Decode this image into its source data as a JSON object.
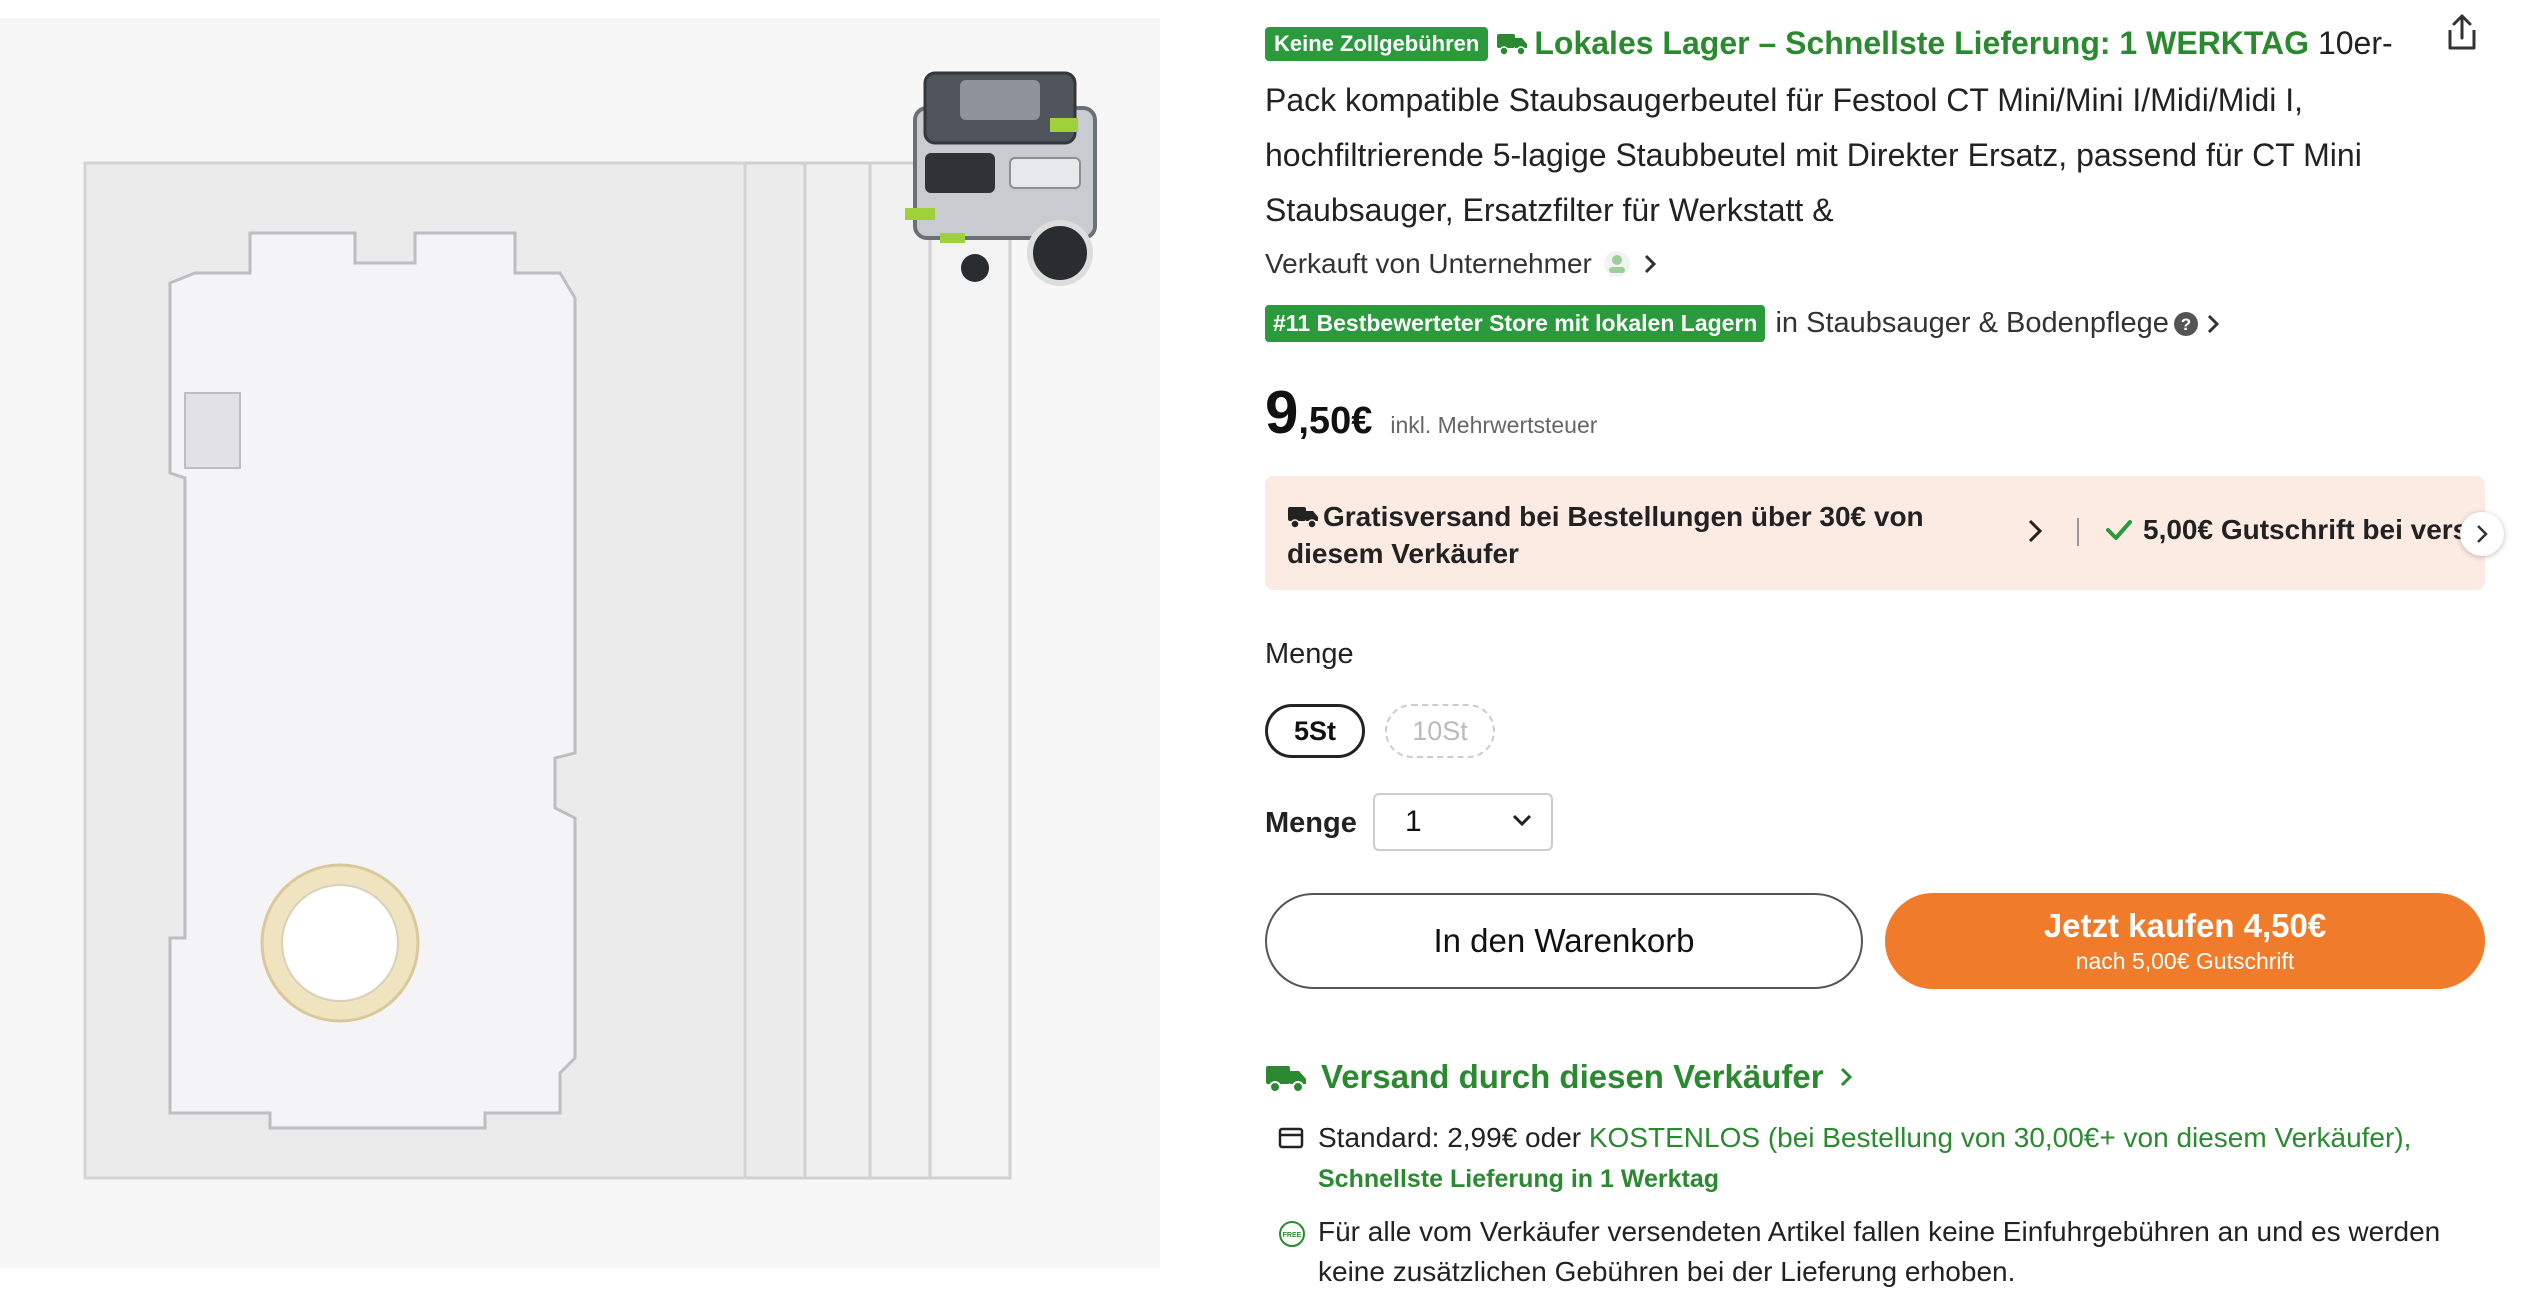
{
  "product": {
    "badge_no_customs": "Keine Zollgebühren",
    "local_stock_headline": "Lokales Lager – Schnellste Lieferung: 1 WERKTAG",
    "title": "10er-Pack kompatible Staubsaugerbeutel für Festool CT Mini/Mini I/Midi/Midi I, hochfiltrierende 5-lagige Staubbeutel mit Direkter Ersatz, passend für CT Mini Staubsauger, Ersatzfilter für Werkstatt &"
  },
  "seller": {
    "label": "Verkauft von Unternehmer"
  },
  "ranking": {
    "badge": "#11 Bestbewerteter Store mit lokalen Lagern",
    "category": "in Staubsauger & Bodenpflege"
  },
  "price": {
    "integer": "9",
    "decimal": ",50€",
    "tax_note": "inkl. Mehrwertsteuer"
  },
  "promo": {
    "shipping": "Gratisversand bei Bestellungen über 30€ von diesem Verkäufer",
    "credit": "5,00€ Gutschrift bei vers"
  },
  "variant": {
    "label": "Menge",
    "options": [
      "5St",
      "10St"
    ],
    "selected": "5St"
  },
  "quantity": {
    "label": "Menge",
    "value": "1"
  },
  "actions": {
    "cart": "In den Warenkorb",
    "buy_main": "Jetzt kaufen 4,50€",
    "buy_sub": "nach 5,00€ Gutschrift"
  },
  "shipping": {
    "heading": "Versand durch diesen Verkäufer",
    "standard_prefix": "Standard: 2,99€ oder ",
    "standard_free": "KOSTENLOS (bei Bestellung von 30,00€+ von diesem Verkäufer),",
    "fastest": "Schnellste Lieferung in 1 Werktag",
    "free_icon_text": "FREE",
    "import_note": "Für alle vom Verkäufer versendeten Artikel fallen keine Einfuhrgebühren an und es werden keine zusätzlichen Gebühren bei der Lieferung erhoben."
  },
  "colors": {
    "green": "#2b9a3d",
    "orange": "#f07c2b",
    "promo_bg": "#fcebe3"
  }
}
